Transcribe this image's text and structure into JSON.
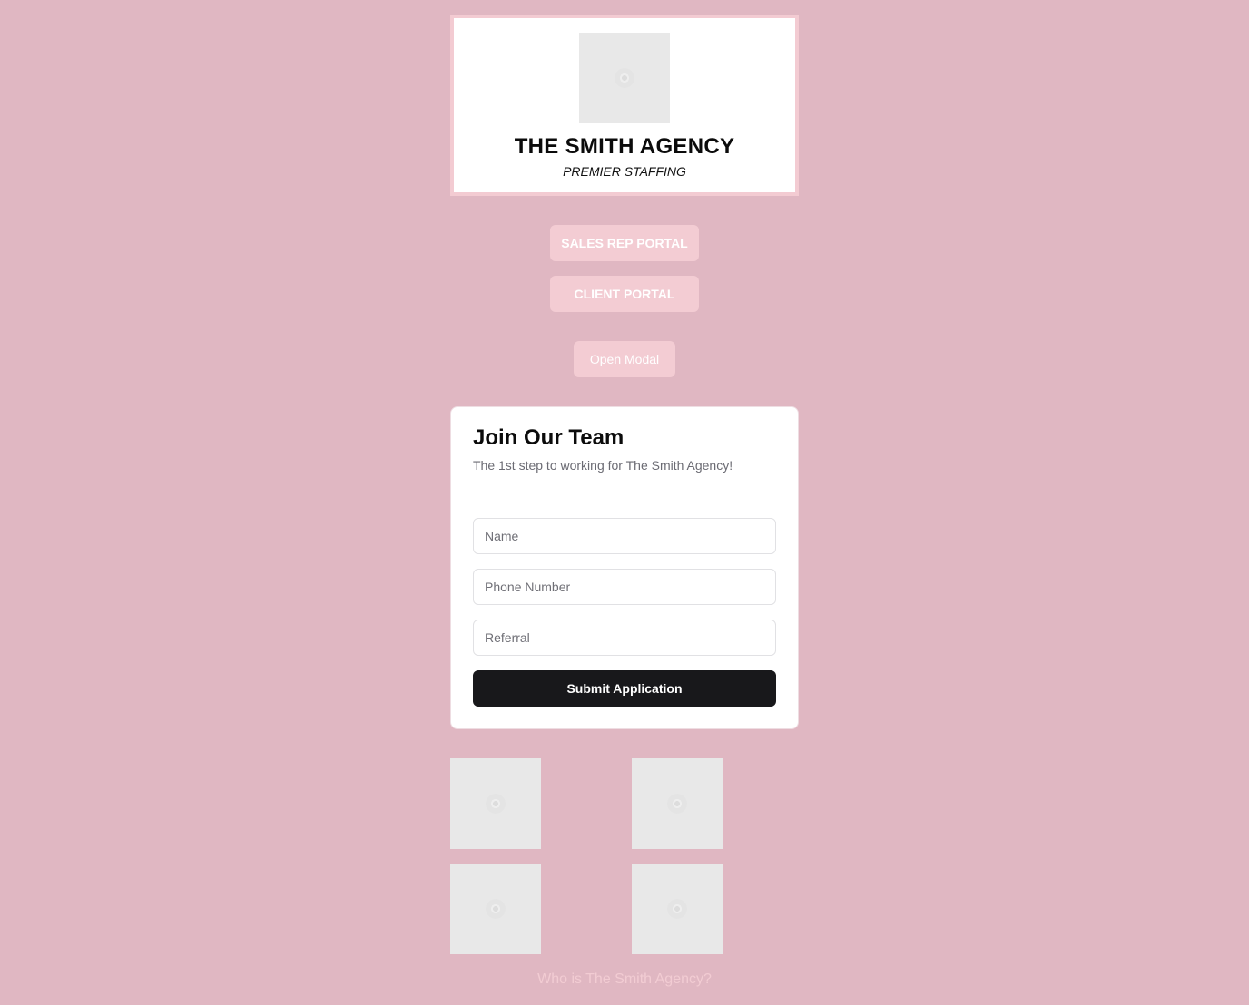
{
  "header": {
    "agency_name": "THE SMITH AGENCY",
    "tagline": "PREMIER STAFFING"
  },
  "nav": {
    "sales_rep_portal": "SALES REP PORTAL",
    "client_portal": "CLIENT PORTAL",
    "open_modal": "Open Modal"
  },
  "form": {
    "title": "Join Our Team",
    "subtitle": "The 1st step to working for The Smith Agency!",
    "name_placeholder": "Name",
    "name_value": "",
    "phone_placeholder": "Phone Number",
    "phone_value": "",
    "referral_placeholder": "Referral",
    "referral_value": "",
    "submit_label": "Submit Application"
  },
  "footer": {
    "about_link": "Who is The Smith Agency?"
  },
  "colors": {
    "background": "#e0b7c2",
    "accent_pink": "#f3ccd3",
    "submit_dark": "#18181b"
  }
}
